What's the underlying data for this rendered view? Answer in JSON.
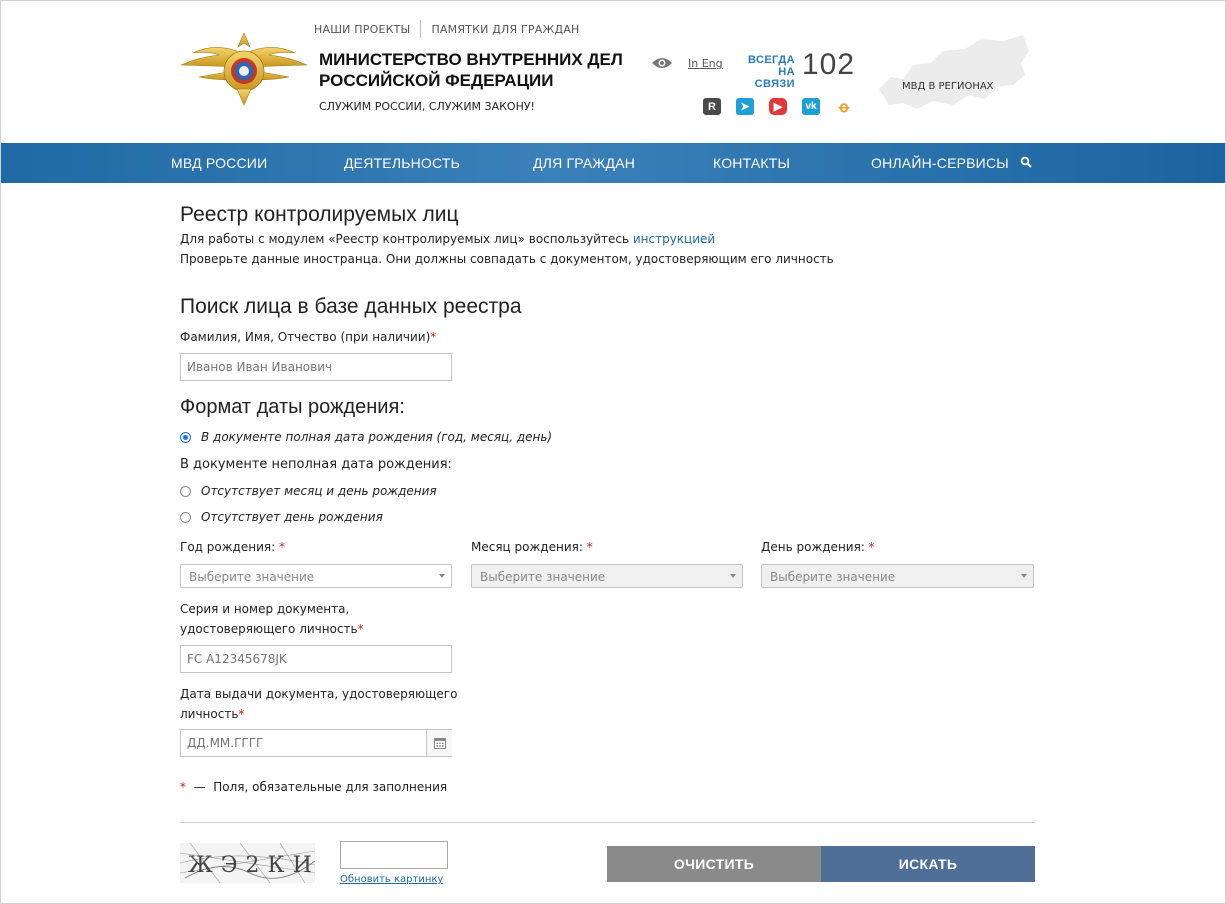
{
  "header": {
    "top_links": [
      "НАШИ ПРОЕКТЫ",
      "ПАМЯТКИ ДЛЯ ГРАЖДАН"
    ],
    "title": "МИНИСТЕРСТВО ВНУТРЕННИХ ДЕЛ РОССИЙСКОЙ ФЕДЕРАЦИИ",
    "motto": "СЛУЖИМ РОССИИ, СЛУЖИМ ЗАКОНУ!",
    "lang_link": "In Eng",
    "always_line1": "ВСЕГДА",
    "always_line2": "НА СВЯЗИ",
    "phone": "102",
    "socials": [
      {
        "name": "rutube-icon",
        "glyph": "R"
      },
      {
        "name": "telegram-icon",
        "glyph": "➤"
      },
      {
        "name": "youtube-icon",
        "glyph": "▶"
      },
      {
        "name": "vk-icon",
        "glyph": "vk"
      },
      {
        "name": "odnoklassniki-icon",
        "glyph": "ꝋ"
      }
    ],
    "regions_label": "МВД В РЕГИОНАХ"
  },
  "nav": {
    "items": [
      "МВД РОССИИ",
      "ДЕЯТЕЛЬНОСТЬ",
      "ДЛЯ ГРАЖДАН",
      "КОНТАКТЫ",
      "ОНЛАЙН-СЕРВИСЫ"
    ]
  },
  "content": {
    "title": "Реестр контролируемых лиц",
    "intro_text": "Для работы с модулем «Реестр контролируемых лиц» воспользуйтесь ",
    "intro_link": "инструкцией",
    "check_text": "Проверьте данные иностранца. Они должны совпадать с документом, удостоверяющим его личность",
    "search_title": "Поиск лица в базе данных реестра",
    "fio_label": "Фамилия, Имя, Отчество (при наличии)",
    "fio_placeholder": "Иванов Иван Иванович",
    "dob_format_title": "Формат даты рождения:",
    "radio_full": "В документе полная дата рождения (год, месяц, день)",
    "partial_label": "В документе неполная дата рождения:",
    "radio_no_month_day": "Отсутствует месяц и день рождения",
    "radio_no_day": "Отсутствует день рождения",
    "year_label": "Год рождения: ",
    "month_label": "Месяц рождения: ",
    "day_label": "День рождения: ",
    "select_placeholder": "Выберите значение",
    "doc_label_line1": "Серия и номер документа,",
    "doc_label_line2": "удостоверяющего личность",
    "doc_placeholder": "FC A12345678JK",
    "issue_label_line1": "Дата выдачи документа, удостоверяющего",
    "issue_label_line2": "личность",
    "issue_placeholder": "ДД.ММ.ГГГГ",
    "required_star": "*",
    "required_note": "  —  Поля, обязательные для заполнения",
    "captcha_text": "ЖЭ2КИ",
    "refresh_link": "Обновить картинку",
    "clear_button": "ОЧИСТИТЬ",
    "search_button": "ИСКАТЬ"
  },
  "colors": {
    "nav_blue": "#2c74ae",
    "link_blue": "#1f6aa5",
    "required_red": "#d02020",
    "clear_gray": "#8a8a8a",
    "search_blue": "#4f6f98"
  }
}
